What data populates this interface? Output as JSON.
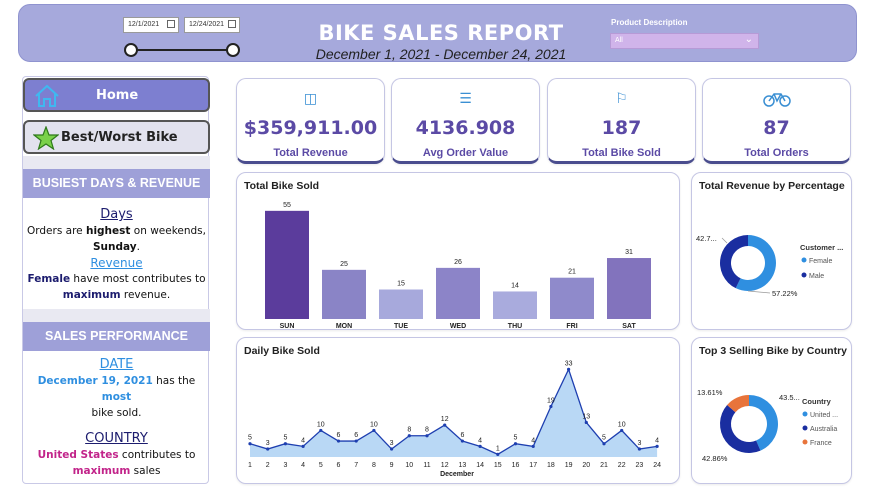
{
  "header": {
    "title": "BIKE SALES REPORT",
    "subtitle": "December 1, 2021 - December 24, 2021",
    "date_start": "12/1/2021",
    "date_end": "12/24/2021",
    "product_label": "Product Description",
    "product_value": "All"
  },
  "sidebar": {
    "home_label": "Home",
    "best_worst_label": "Best/Worst Bike",
    "busiest_header": "BUSIEST DAYS & REVENUE",
    "days_title": "Days",
    "days_line1_a": "Orders are ",
    "days_line1_b": "highest",
    "days_line1_c": " on weekends,",
    "days_line2": "Sunday",
    "days_line2_end": ".",
    "revenue_title": "Revenue",
    "revenue_line1_a": "Female",
    "revenue_line1_b": " have most contributes to",
    "revenue_line2_a": "maximum",
    "revenue_line2_b": " revenue.",
    "perf_header": "SALES PERFORMANCE",
    "date_title": "DATE",
    "date_line1_a": "December 19, 2021",
    "date_line1_b": " has the ",
    "date_line1_c": "most",
    "date_line2": "bike sold.",
    "country_title": "COUNTRY",
    "country_line1_a": "United States",
    "country_line1_b": " contributes to",
    "country_line2_a": "maximum",
    "country_line2_b": " sales",
    "colors": {
      "accent_blue": "#2f8fe0",
      "accent_pink": "#c2248a",
      "dark_navy": "#1c1c6e"
    }
  },
  "kpis": [
    {
      "icon": "money-bag-icon",
      "value": "$359,911.00",
      "label": "Total Revenue"
    },
    {
      "icon": "clipboard-icon",
      "value": "4136.908",
      "label": "Avg Order Value"
    },
    {
      "icon": "cyclist-icon",
      "value": "187",
      "label": "Total Bike Sold"
    },
    {
      "icon": "bicycle-icon",
      "value": "87",
      "label": "Total Orders"
    }
  ],
  "panels": {
    "bike_sold_title": "Total Bike Sold",
    "daily_title": "Daily Bike Sold",
    "revenue_pct_title": "Total Revenue by Percentage",
    "top3_title": "Top 3 Selling Bike by Country"
  },
  "chart_data": [
    {
      "type": "bar",
      "title": "Total Bike Sold",
      "categories": [
        "SUN",
        "MON",
        "TUE",
        "WED",
        "THU",
        "FRI",
        "SAT"
      ],
      "values": [
        55,
        25,
        15,
        26,
        14,
        21,
        31
      ],
      "colors": [
        "#5b3c9c",
        "#8a84c6",
        "#a7a9dc",
        "#8c84c8",
        "#a9abdd",
        "#8f8acb",
        "#8273bd"
      ],
      "ylim": [
        0,
        60
      ]
    },
    {
      "type": "area",
      "title": "Daily Bike Sold",
      "xlabel": "December",
      "x": [
        1,
        2,
        3,
        4,
        5,
        6,
        7,
        8,
        9,
        10,
        11,
        12,
        13,
        14,
        15,
        16,
        17,
        18,
        19,
        20,
        21,
        22,
        23,
        24
      ],
      "values": [
        5,
        3,
        5,
        4,
        10,
        6,
        6,
        10,
        3,
        8,
        8,
        12,
        6,
        4,
        1,
        5,
        4,
        19,
        33,
        13,
        5,
        10,
        3,
        4
      ],
      "color": "#1e3fb0",
      "fill": "#b9d8f5",
      "ylim": [
        0,
        35
      ]
    },
    {
      "type": "pie",
      "title": "Total Revenue by Percentage",
      "legend_title": "Customer ...",
      "labels": [
        "Female",
        "Male"
      ],
      "values": [
        57.22,
        42.78
      ],
      "value_labels": [
        "57.22%",
        "42.7..."
      ],
      "colors": [
        "#2f8fe0",
        "#1a2ea0"
      ]
    },
    {
      "type": "pie",
      "title": "Top 3 Selling Bike by Country",
      "legend_title": "Country",
      "labels": [
        "United ...",
        "Australia",
        "France"
      ],
      "values": [
        43.53,
        42.86,
        13.61
      ],
      "value_labels": [
        "43.5...",
        "42.86%",
        "13.61%"
      ],
      "colors": [
        "#2f8fe0",
        "#1a2ea0",
        "#e8743b"
      ]
    }
  ]
}
